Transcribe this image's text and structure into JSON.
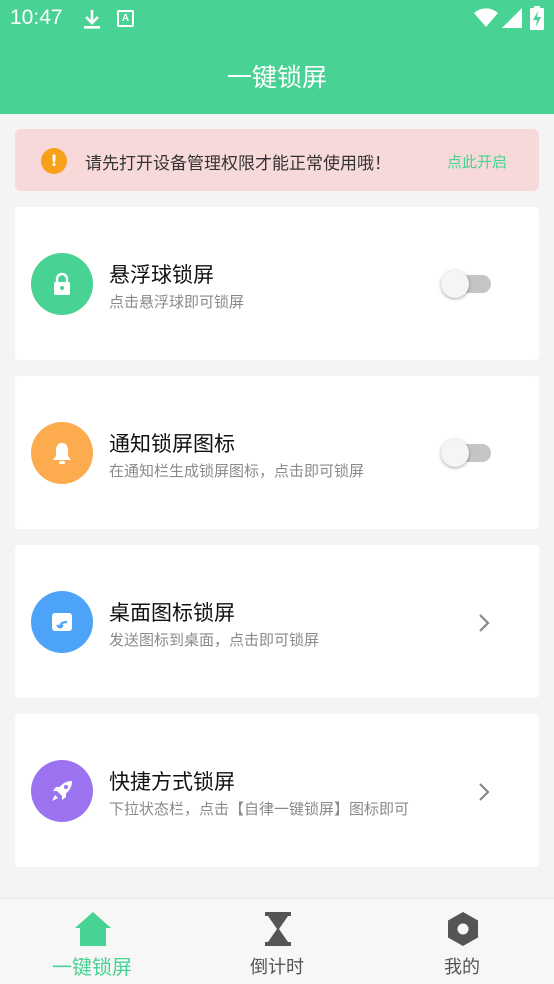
{
  "status_bar": {
    "time": "10:47",
    "a_badge": "A"
  },
  "header": {
    "title": "一键锁屏"
  },
  "banner": {
    "icon": "exclamation-icon",
    "icon_glyph": "!",
    "text": "请先打开设备管理权限才能正常使用哦！",
    "link": "点此开启"
  },
  "cards": [
    {
      "title": "悬浮球锁屏",
      "subtitle": "点击悬浮球即可锁屏",
      "icon": "lock-icon",
      "color": "#48d293",
      "control": "toggle",
      "enabled": false
    },
    {
      "title": "通知锁屏图标",
      "subtitle": "在通知栏生成锁屏图标，点击即可锁屏",
      "icon": "bell-icon",
      "color": "#fdab4f",
      "control": "toggle",
      "enabled": false
    },
    {
      "title": "桌面图标锁屏",
      "subtitle": "发送图标到桌面，点击即可锁屏",
      "icon": "desktop-shortcut-icon",
      "color": "#4da3f7",
      "control": "chevron"
    },
    {
      "title": "快捷方式锁屏",
      "subtitle": "下拉状态栏，点击【自律一键锁屏】图标即可",
      "icon": "rocket-icon",
      "color": "#9b72f0",
      "control": "chevron"
    }
  ],
  "bottom_nav": [
    {
      "label": "一键锁屏",
      "icon": "home-icon",
      "active": true
    },
    {
      "label": "倒计时",
      "icon": "hourglass-icon",
      "active": false
    },
    {
      "label": "我的",
      "icon": "hexagon-profile-icon",
      "active": false
    }
  ],
  "colors": {
    "accent": "#48d293",
    "banner_bg": "#f8d9da",
    "warning": "#f7a11b"
  }
}
